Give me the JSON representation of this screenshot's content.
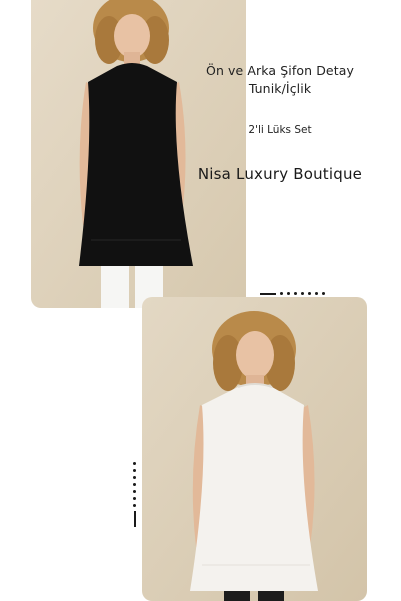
{
  "product": {
    "title_line1": "Ön ve Arka Şifon Detay",
    "title_line2": "Tunik/İçlik",
    "set_label": "2'li Lüks Set",
    "brand": "Nisa Luxury Boutique"
  },
  "colors": {
    "tunic_black": "#111111",
    "tunic_white": "#f4f2ee",
    "background_top": "#ddd1bb",
    "background_bottom": "#ddd0ba",
    "accent": "#1a1a1a"
  }
}
